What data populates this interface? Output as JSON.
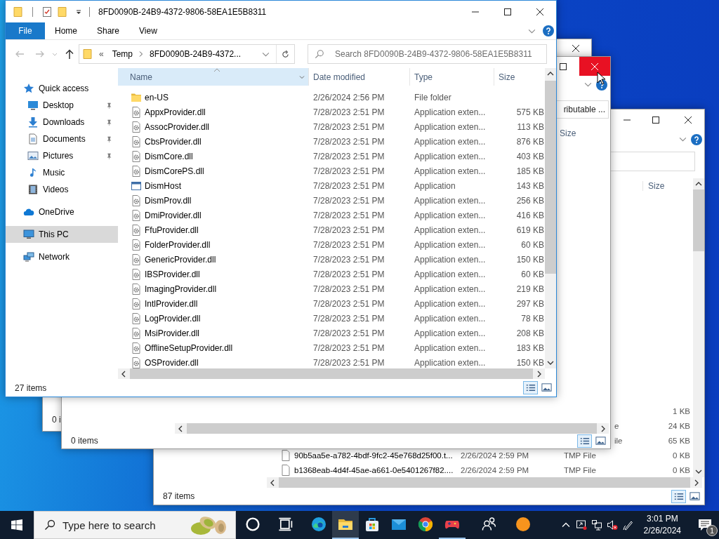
{
  "window_a": {
    "status": "0 i"
  },
  "window_c": {
    "column": "Size",
    "rows": [
      {
        "kind": "partial",
        "size": "1 KB"
      },
      {
        "kind": "partial",
        "type": "e",
        "size": "24 KB"
      },
      {
        "kind": "partial",
        "type": "ile",
        "size": "65 KB"
      },
      {
        "kind": "file",
        "name": "90b5aa5e-a782-4bdf-9fc2-45e768d25f00.t...",
        "date": "2/26/2024 2:59 PM",
        "type": "TMP File",
        "size": "0 KB"
      },
      {
        "kind": "file",
        "name": "b1368eab-4d4f-45ae-a661-0e5401267f82....",
        "date": "2/26/2024 2:59 PM",
        "type": "TMP File",
        "size": "0 KB"
      }
    ],
    "status": "87 items",
    "views": [
      {
        "kind": "details",
        "selected": true
      },
      {
        "kind": "large-icons",
        "selected": false
      }
    ]
  },
  "window_b": {
    "close_hovered": true,
    "field_value": "ributable ...",
    "column": "Size",
    "status": "0 items",
    "views": [
      {
        "kind": "details",
        "selected": true
      },
      {
        "kind": "large-icons",
        "selected": false
      }
    ]
  },
  "main_window": {
    "title": "8FD0090B-24B9-4372-9806-58EA1E5B8311",
    "ribbon_tabs": [
      {
        "label": "File",
        "kind": "menu",
        "selected": false
      },
      {
        "label": "Home",
        "kind": "tab",
        "selected": false
      },
      {
        "label": "Share",
        "kind": "tab",
        "selected": false
      },
      {
        "label": "View",
        "kind": "tab",
        "selected": false
      }
    ],
    "address": {
      "overflow": "«",
      "crumbs": [
        "Temp",
        "8FD0090B-24B9-4372..."
      ]
    },
    "search": {
      "placeholder": "Search 8FD0090B-24B9-4372-9806-58EA1E5B8311"
    },
    "nav": [
      {
        "label": "Quick access",
        "kind": "star",
        "selected": false,
        "children": [
          {
            "label": "Desktop",
            "kind": "desktop",
            "pinned": true,
            "selected": false
          },
          {
            "label": "Downloads",
            "kind": "downloads",
            "pinned": true,
            "selected": false
          },
          {
            "label": "Documents",
            "kind": "documents",
            "pinned": true,
            "selected": false
          },
          {
            "label": "Pictures",
            "kind": "pictures",
            "pinned": true,
            "selected": false
          },
          {
            "label": "Music",
            "kind": "music",
            "pinned": false,
            "selected": false
          },
          {
            "label": "Videos",
            "kind": "videos",
            "pinned": false,
            "selected": false
          }
        ]
      },
      {
        "label": "OneDrive",
        "kind": "cloud",
        "selected": false
      },
      {
        "label": "This PC",
        "kind": "pc",
        "selected": true
      },
      {
        "label": "Network",
        "kind": "network",
        "selected": false
      }
    ],
    "columns": [
      {
        "label": "Name",
        "sorted": true
      },
      {
        "label": "Date modified",
        "sorted": false
      },
      {
        "label": "Type",
        "sorted": false
      },
      {
        "label": "Size",
        "sorted": false
      }
    ],
    "rows": [
      {
        "kind": "folder",
        "name": "en-US",
        "date": "2/26/2024 2:56 PM",
        "type": "File folder"
      },
      {
        "kind": "dll",
        "name": "AppxProvider.dll",
        "date": "7/28/2023 2:51 PM",
        "type": "Application exten...",
        "size": "575 KB"
      },
      {
        "kind": "dll",
        "name": "AssocProvider.dll",
        "date": "7/28/2023 2:51 PM",
        "type": "Application exten...",
        "size": "113 KB"
      },
      {
        "kind": "dll",
        "name": "CbsProvider.dll",
        "date": "7/28/2023 2:51 PM",
        "type": "Application exten...",
        "size": "876 KB"
      },
      {
        "kind": "dll",
        "name": "DismCore.dll",
        "date": "7/28/2023 2:51 PM",
        "type": "Application exten...",
        "size": "403 KB"
      },
      {
        "kind": "dll",
        "name": "DismCorePS.dll",
        "date": "7/28/2023 2:51 PM",
        "type": "Application exten...",
        "size": "185 KB"
      },
      {
        "kind": "app",
        "name": "DismHost",
        "date": "7/28/2023 2:51 PM",
        "type": "Application",
        "size": "143 KB"
      },
      {
        "kind": "dll",
        "name": "DismProv.dll",
        "date": "7/28/2023 2:51 PM",
        "type": "Application exten...",
        "size": "256 KB"
      },
      {
        "kind": "dll",
        "name": "DmiProvider.dll",
        "date": "7/28/2023 2:51 PM",
        "type": "Application exten...",
        "size": "416 KB"
      },
      {
        "kind": "dll",
        "name": "FfuProvider.dll",
        "date": "7/28/2023 2:51 PM",
        "type": "Application exten...",
        "size": "619 KB"
      },
      {
        "kind": "dll",
        "name": "FolderProvider.dll",
        "date": "7/28/2023 2:51 PM",
        "type": "Application exten...",
        "size": "60 KB"
      },
      {
        "kind": "dll",
        "name": "GenericProvider.dll",
        "date": "7/28/2023 2:51 PM",
        "type": "Application exten...",
        "size": "150 KB"
      },
      {
        "kind": "dll",
        "name": "IBSProvider.dll",
        "date": "7/28/2023 2:51 PM",
        "type": "Application exten...",
        "size": "60 KB"
      },
      {
        "kind": "dll",
        "name": "ImagingProvider.dll",
        "date": "7/28/2023 2:51 PM",
        "type": "Application exten...",
        "size": "219 KB"
      },
      {
        "kind": "dll",
        "name": "IntlProvider.dll",
        "date": "7/28/2023 2:51 PM",
        "type": "Application exten...",
        "size": "297 KB"
      },
      {
        "kind": "dll",
        "name": "LogProvider.dll",
        "date": "7/28/2023 2:51 PM",
        "type": "Application exten...",
        "size": "78 KB"
      },
      {
        "kind": "dll",
        "name": "MsiProvider.dll",
        "date": "7/28/2023 2:51 PM",
        "type": "Application exten...",
        "size": "208 KB"
      },
      {
        "kind": "dll",
        "name": "OfflineSetupProvider.dll",
        "date": "7/28/2023 2:51 PM",
        "type": "Application exten...",
        "size": "183 KB"
      },
      {
        "kind": "dll",
        "name": "OSProvider.dll",
        "date": "7/28/2023 2:51 PM",
        "type": "Application exten...",
        "size": "150 KB"
      }
    ],
    "status": "27 items",
    "views": [
      {
        "kind": "details",
        "selected": true
      },
      {
        "kind": "large-icons",
        "selected": false
      }
    ]
  },
  "taskbar": {
    "search_placeholder": "Type here to search",
    "apps": [
      {
        "kind": "cortana",
        "running": false,
        "selected": false
      },
      {
        "kind": "task-view",
        "running": false,
        "selected": false
      },
      {
        "kind": "edge",
        "running": false,
        "selected": false
      },
      {
        "kind": "explorer",
        "running": true,
        "selected": true
      },
      {
        "kind": "store",
        "running": false,
        "selected": false
      },
      {
        "kind": "mail",
        "running": false,
        "selected": false
      },
      {
        "kind": "chrome",
        "running": false,
        "selected": false
      },
      {
        "kind": "game",
        "running": true,
        "selected": false
      },
      {
        "kind": "people",
        "running": false,
        "selected": false
      },
      {
        "kind": "orange",
        "running": false,
        "selected": false
      }
    ],
    "tray": [
      {
        "kind": "overflow"
      },
      {
        "kind": "display"
      },
      {
        "kind": "network"
      },
      {
        "kind": "volume-muted"
      },
      {
        "kind": "pen"
      }
    ],
    "clock": {
      "time": "3:01 PM",
      "date": "2/26/2024"
    },
    "notifications": {
      "count": "1"
    }
  }
}
